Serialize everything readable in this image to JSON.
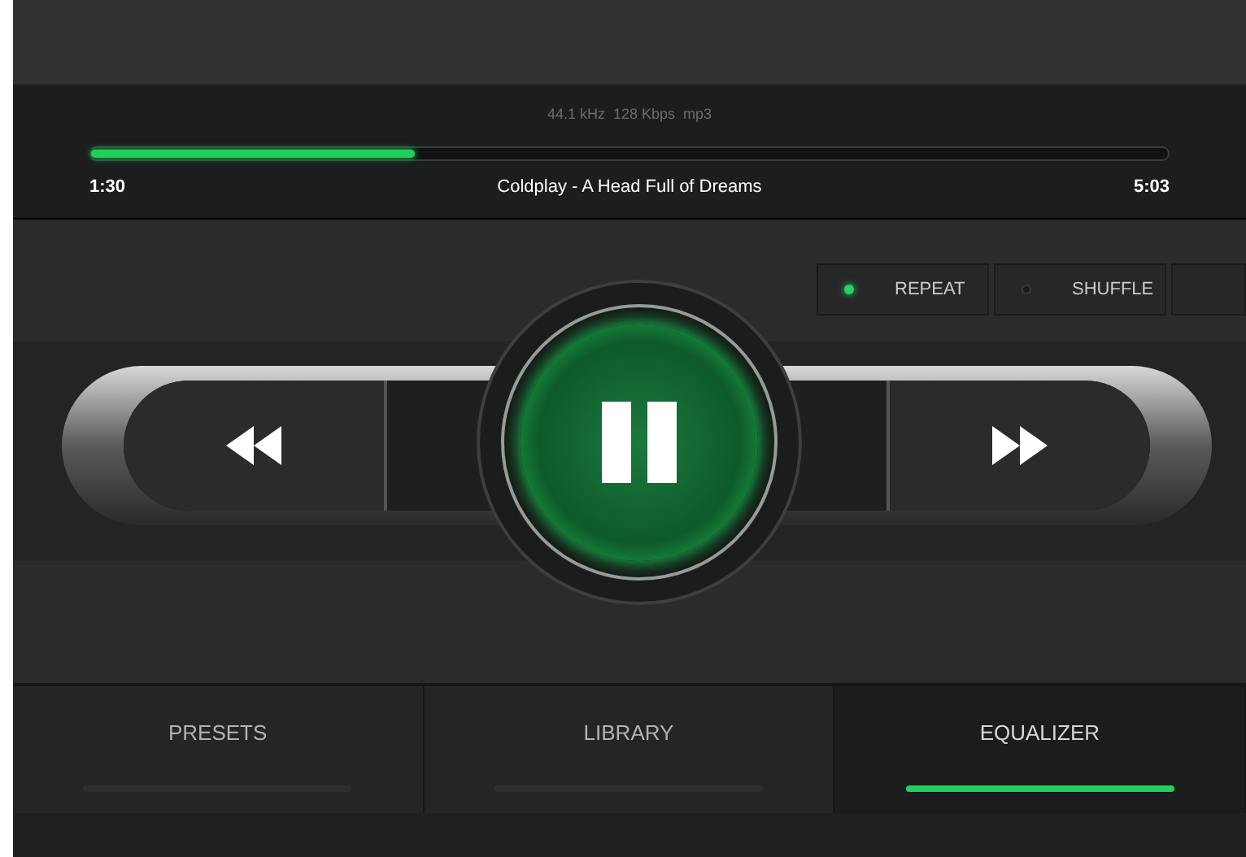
{
  "track": {
    "format": "44.1 kHz  128 Kbps  mp3",
    "level": 0.3,
    "elapsed": "1:30",
    "title": "Coldplay - A Head Full of Dreams",
    "duration": "5:03"
  },
  "toggles": [
    {
      "label": "REPEAT",
      "on": true
    },
    {
      "label": "SHUFFLE",
      "on": false
    }
  ],
  "playback": {
    "playing": true
  },
  "tabs": [
    {
      "label": "PRESETS",
      "selected": false
    },
    {
      "label": "LIBRARY",
      "selected": false
    },
    {
      "label": "EQUALIZER",
      "selected": true
    }
  ]
}
